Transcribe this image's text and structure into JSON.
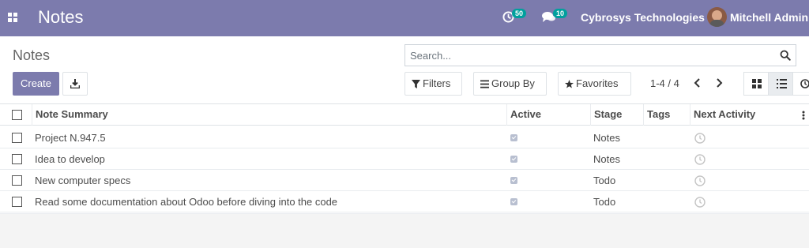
{
  "navbar": {
    "title": "Notes",
    "activity_count": "50",
    "messages_count": "10",
    "company": "Cybrosys Technologies",
    "user": "Mitchell Admin"
  },
  "control": {
    "breadcrumb": "Notes",
    "search_placeholder": "Search...",
    "create_label": "Create",
    "filters_label": "Filters",
    "groupby_label": "Group By",
    "favorites_label": "Favorites",
    "pager": "1-4 / 4"
  },
  "table": {
    "columns": [
      "Note Summary",
      "Active",
      "Stage",
      "Tags",
      "Next Activity"
    ],
    "rows": [
      {
        "summary": "Project N.947.5",
        "active": true,
        "stage": "Notes",
        "tags": ""
      },
      {
        "summary": "Idea to develop",
        "active": true,
        "stage": "Notes",
        "tags": ""
      },
      {
        "summary": "New computer specs",
        "active": true,
        "stage": "Todo",
        "tags": ""
      },
      {
        "summary": "Read some documentation about Odoo before diving into the code",
        "active": true,
        "stage": "Todo",
        "tags": ""
      }
    ]
  },
  "colors": {
    "brand": "#7c7bad",
    "badge": "#00a09d"
  },
  "icons": [
    "apps-icon",
    "activity-clock-icon",
    "chat-icon",
    "search-icon",
    "download-icon",
    "filter-icon",
    "groupby-icon",
    "star-icon",
    "chevron-left-icon",
    "chevron-right-icon",
    "kanban-view-icon",
    "list-view-icon",
    "activity-view-icon",
    "kebab-icon"
  ]
}
